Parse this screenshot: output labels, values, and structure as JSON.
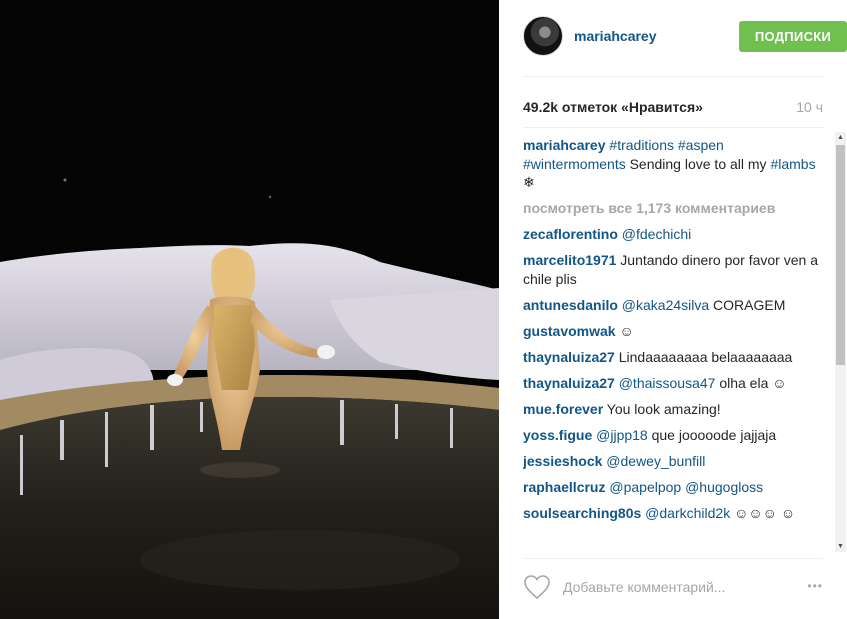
{
  "post": {
    "photo_alt": "",
    "author": {
      "username": "mariahcarey"
    },
    "follow_label": "ПОДПИСКИ",
    "likes_text": "49.2k отметок «Нравится»",
    "time_ago": "10 ч",
    "caption": {
      "username": "mariahcarey",
      "parts": [
        {
          "text": "#traditions",
          "tag": true
        },
        {
          "text": " ",
          "tag": false
        },
        {
          "text": "#aspen",
          "tag": true
        },
        {
          "text": " ",
          "tag": false
        },
        {
          "text": "#wintermoments",
          "tag": true
        },
        {
          "text": " Sending love to all my ",
          "tag": false
        },
        {
          "text": "#lambs",
          "tag": true
        },
        {
          "text": " ❄",
          "tag": false
        }
      ]
    },
    "view_all_text": "посмотреть все 1,173 комментариев",
    "comments": [
      {
        "username": "zecaflorentino",
        "parts": [
          {
            "text": "@fdechichi",
            "tag": true
          }
        ]
      },
      {
        "username": "marcelito1971",
        "parts": [
          {
            "text": "Juntando dinero por favor ven a chile plis",
            "tag": false
          }
        ]
      },
      {
        "username": "antunesdanilo",
        "parts": [
          {
            "text": "@kaka24silva",
            "tag": true
          },
          {
            "text": " CORAGEM",
            "tag": false
          }
        ]
      },
      {
        "username": "gustavomwak",
        "parts": [
          {
            "text": "☺",
            "tag": false
          }
        ]
      },
      {
        "username": "thaynaluiza27",
        "parts": [
          {
            "text": "Lindaaaaaaaa belaaaaaaaa",
            "tag": false
          }
        ]
      },
      {
        "username": "thaynaluiza27",
        "parts": [
          {
            "text": "@thaissousa47",
            "tag": true
          },
          {
            "text": " olha ela ☺",
            "tag": false
          }
        ]
      },
      {
        "username": "mue.forever",
        "parts": [
          {
            "text": "You look amazing!",
            "tag": false
          }
        ]
      },
      {
        "username": "yoss.figue",
        "parts": [
          {
            "text": "@jjpp18",
            "tag": true
          },
          {
            "text": " que jooooode jajjaja",
            "tag": false
          }
        ]
      },
      {
        "username": "jessieshock",
        "parts": [
          {
            "text": "@dewey_bunfill",
            "tag": true
          }
        ]
      },
      {
        "username": "raphaellcruz",
        "parts": [
          {
            "text": "@papelpop",
            "tag": true
          },
          {
            "text": " ",
            "tag": false
          },
          {
            "text": "@hugogloss",
            "tag": true
          }
        ]
      },
      {
        "username": "soulsearching80s",
        "parts": [
          {
            "text": "@darkchild2k",
            "tag": true
          },
          {
            "text": " ☺☺☺ ☺",
            "tag": false
          }
        ]
      }
    ],
    "comment_placeholder": "Добавьте комментарий...",
    "more_label": "•••"
  },
  "colors": {
    "link": "#125688",
    "follow_button": "#70c050",
    "muted": "#a5a7aa",
    "text": "#262626"
  },
  "icons": {
    "like": "heart-outline-icon",
    "more": "ellipsis-icon",
    "scroll_up": "triangle-up-icon",
    "scroll_down": "triangle-down-icon"
  }
}
